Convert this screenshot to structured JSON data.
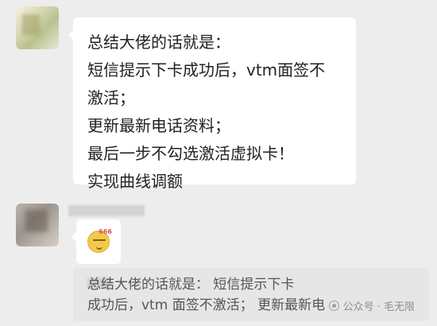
{
  "chat": {
    "messages": [
      {
        "lines": [
          "总结大佬的话就是：",
          "短信提示下卡成功后，vtm面签不",
          "激活；",
          "更新最新电话资料；",
          "最后一步不勾选激活虚拟卡！",
          "实现曲线调额"
        ]
      },
      {
        "sticker_badge": "666"
      }
    ],
    "quoted_message": {
      "line1": "总结大佬的话就是： 短信提示下卡",
      "line2": "成功后，vtm 面签不激活； 更新最新电"
    },
    "watermark": {
      "label": "公众号 · 毛无限"
    }
  }
}
